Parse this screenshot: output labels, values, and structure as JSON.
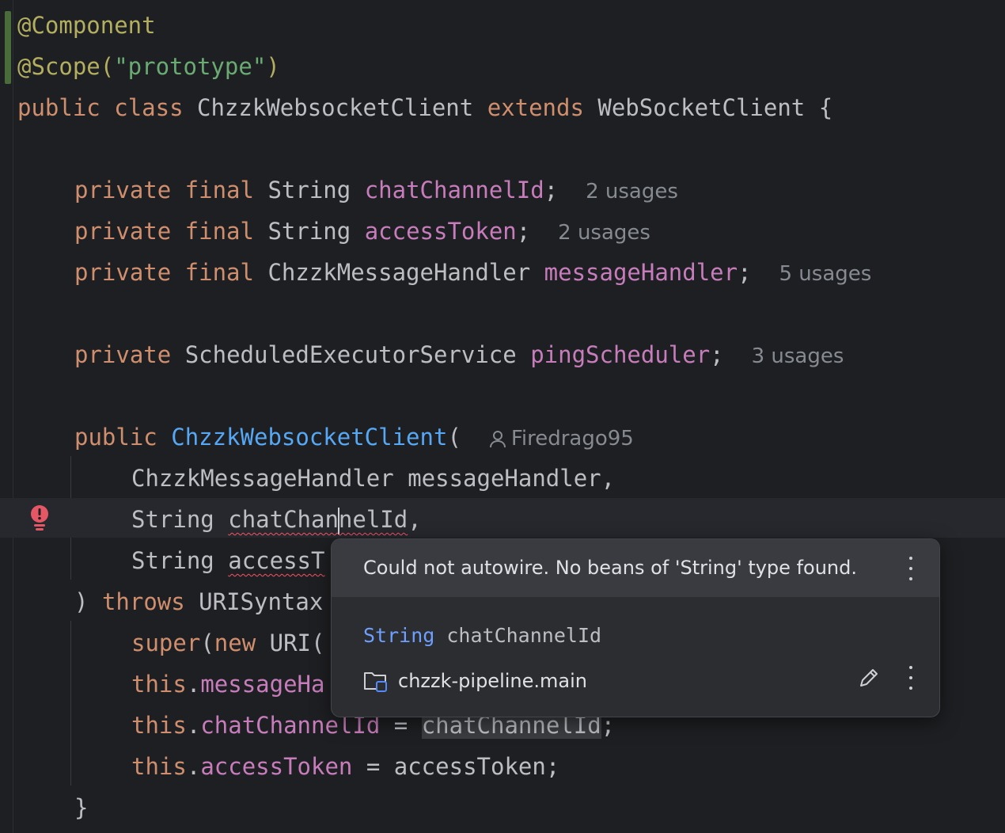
{
  "code": {
    "l1_annotation": "@Component",
    "l2_annotation": "@Scope(",
    "l2_string": "\"prototype\"",
    "l2_close": ")",
    "l3_kw1": "public",
    "l3_kw2": "class",
    "l3_name": "ChzzkWebsocketClient",
    "l3_kw3": "extends",
    "l3_super": "WebSocketClient {",
    "f1": {
      "mods": "private final",
      "type": "String",
      "name": "chatChannelId",
      "end": ";",
      "usages": "2 usages"
    },
    "f2": {
      "mods": "private final",
      "type": "String",
      "name": "accessToken",
      "end": ";",
      "usages": "2 usages"
    },
    "f3": {
      "mods": "private final",
      "type": "ChzzkMessageHandler",
      "name": "messageHandler",
      "end": ";",
      "usages": "5 usages"
    },
    "f4": {
      "mods": "private",
      "type": "ScheduledExecutorService",
      "name": "pingScheduler",
      "end": ";",
      "usages": "3 usages"
    },
    "ctor_kw": "public",
    "ctor_name": "ChzzkWebsocketClient",
    "ctor_paren": "(",
    "ctor_author": "Firedrago95",
    "p1": "ChzzkMessageHandler messageHandler,",
    "p2_type": "String",
    "p2_name_a": "chatChan",
    "p2_name_b": "nelId",
    "p2_comma": ",",
    "p3_type": "String",
    "p3_name": "accessT",
    "throws_paren": ")",
    "throws_kw": "throws",
    "throws_rest": "URISyntax",
    "s1_kw": "super",
    "s1_open": "(",
    "s1_new": "new",
    "s1_rest": "URI(",
    "s2_this": "this",
    "s2_dot": ".",
    "s2_field": "messageHa",
    "s3_this": "this",
    "s3_dot": ".",
    "s3_field": "chatChannelId",
    "s3_eq": " = ",
    "s3_value": "chatChannelId",
    "s3_end": ";",
    "s4_this": "this",
    "s4_dot": ".",
    "s4_field": "accessToken",
    "s4_eq": " = ",
    "s4_value": "accessToken",
    "s4_end": ";",
    "close_brace": "}"
  },
  "popup": {
    "message": "Could not autowire. No beans of 'String' type found.",
    "signature_type": "String",
    "signature_name": "chatChannelId",
    "module": "chzzk-pipeline.main"
  },
  "icons": {
    "error": "error-bulb-icon",
    "author": "person-icon",
    "module": "module-folder-icon",
    "edit": "pencil-icon",
    "more": "kebab-menu-icon"
  },
  "colors": {
    "background": "#1e1f22",
    "keyword": "#cf8e6d",
    "annotation": "#b3ae60",
    "string": "#6aab73",
    "field": "#c77dbb",
    "function": "#56a8f5",
    "error": "#f75464"
  }
}
